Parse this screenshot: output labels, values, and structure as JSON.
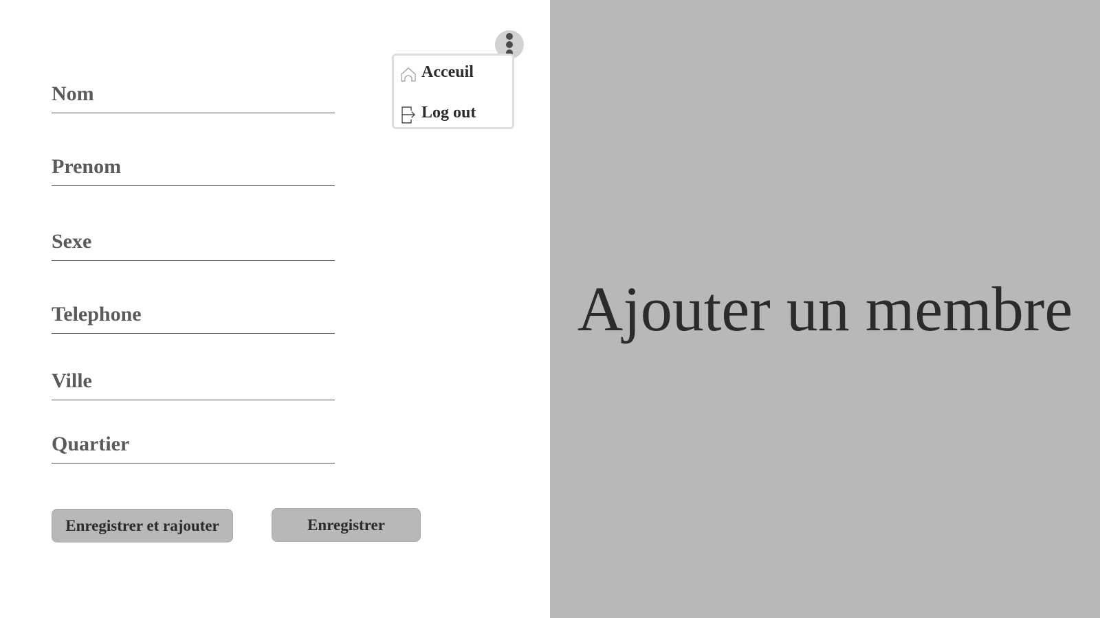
{
  "form": {
    "fields": [
      {
        "placeholder": "Nom",
        "value": ""
      },
      {
        "placeholder": "Prenom",
        "value": ""
      },
      {
        "placeholder": "Sexe",
        "value": ""
      },
      {
        "placeholder": "Telephone",
        "value": ""
      },
      {
        "placeholder": "Ville",
        "value": ""
      },
      {
        "placeholder": "Quartier",
        "value": ""
      }
    ],
    "save_and_add_label": "Enregistrer et rajouter",
    "save_label": "Enregistrer"
  },
  "menu": {
    "home_label": "Acceuil",
    "logout_label": "Log out",
    "home_icon": "home-icon",
    "logout_icon": "logout-icon",
    "trigger_icon": "more-vertical-icon"
  },
  "hero": {
    "title": "Ajouter un membre"
  },
  "colors": {
    "panel_background": "#b8b8b8",
    "button_background": "#b8b8b8",
    "text_dark": "#2b2b2b",
    "placeholder_text": "#5a5a5a"
  }
}
